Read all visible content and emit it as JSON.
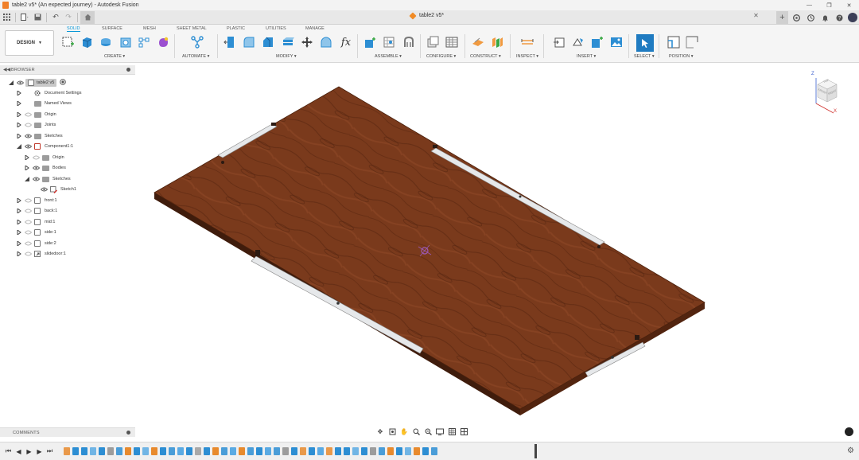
{
  "window": {
    "title": "table2 v5* (An expected journey) - Autodesk Fusion",
    "controls": [
      "—",
      "❐",
      "✕"
    ]
  },
  "document_tab": {
    "label": "table2 v5*"
  },
  "toolbar": {
    "workspace": "DESIGN",
    "tabs": [
      "SOLID",
      "SURFACE",
      "MESH",
      "SHEET METAL",
      "PLASTIC",
      "UTILITIES",
      "MANAGE"
    ],
    "active_tab": "SOLID",
    "groups": [
      "CREATE",
      "AUTOMATE",
      "MODIFY",
      "ASSEMBLE",
      "CONFIGURE",
      "CONSTRUCT",
      "INSPECT",
      "INSERT",
      "SELECT",
      "POSITION"
    ],
    "formula_glyph": "fx"
  },
  "browser": {
    "title": "BROWSER",
    "root": "table2 v5",
    "items": [
      {
        "label": "Document Settings"
      },
      {
        "label": "Named Views"
      },
      {
        "label": "Origin"
      },
      {
        "label": "Joints"
      },
      {
        "label": "Sketches"
      },
      {
        "label": "Component1:1"
      },
      {
        "label": "Origin"
      },
      {
        "label": "Bodies"
      },
      {
        "label": "Sketches"
      },
      {
        "label": "Sketch1"
      },
      {
        "label": "front:1"
      },
      {
        "label": "back:1"
      },
      {
        "label": "mid:1"
      },
      {
        "label": "side:1"
      },
      {
        "label": "side:2"
      },
      {
        "label": "slidedoor:1"
      }
    ]
  },
  "comments": {
    "title": "COMMENTS"
  },
  "viewcube": {
    "faces": [
      "TOP",
      "FRONT",
      "RIGHT"
    ],
    "axes": [
      "Z",
      "X"
    ]
  },
  "colors": {
    "accent": "#0696d7",
    "wood": "#7a3a1c",
    "wood_dark": "#4e2210",
    "rail": "#d4d6d8",
    "brand": "#f0802a"
  }
}
